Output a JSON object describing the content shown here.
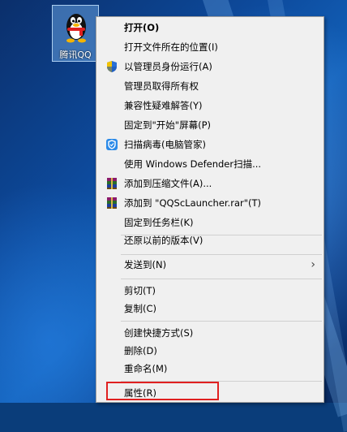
{
  "desktop": {
    "icon_label": "腾讯QQ"
  },
  "menu": {
    "items": [
      {
        "label": "打开(O)"
      },
      {
        "label": "打开文件所在的位置(I)"
      },
      {
        "label": "以管理员身份运行(A)",
        "icon": "uac-shield-icon"
      },
      {
        "label": "管理员取得所有权"
      },
      {
        "label": "兼容性疑难解答(Y)"
      },
      {
        "label": "固定到\"开始\"屏幕(P)"
      },
      {
        "label": "扫描病毒(电脑管家)",
        "icon": "pc-manager-shield-icon"
      },
      {
        "label": "使用 Windows Defender扫描..."
      },
      {
        "label": "添加到压缩文件(A)...",
        "icon": "winrar-icon"
      },
      {
        "label": "添加到 \"QQScLauncher.rar\"(T)",
        "icon": "winrar-icon"
      },
      {
        "label": "固定到任务栏(K)"
      },
      {
        "label": "还原以前的版本(V)"
      },
      {
        "label": "发送到(N)"
      },
      {
        "label": "剪切(T)"
      },
      {
        "label": "复制(C)"
      },
      {
        "label": "创建快捷方式(S)"
      },
      {
        "label": "删除(D)"
      },
      {
        "label": "重命名(M)"
      },
      {
        "label": "属性(R)"
      }
    ]
  },
  "colors": {
    "menu_bg": "#f0f0f0",
    "highlight_border": "#e02020",
    "desktop_blue": "#0d4a9c"
  }
}
